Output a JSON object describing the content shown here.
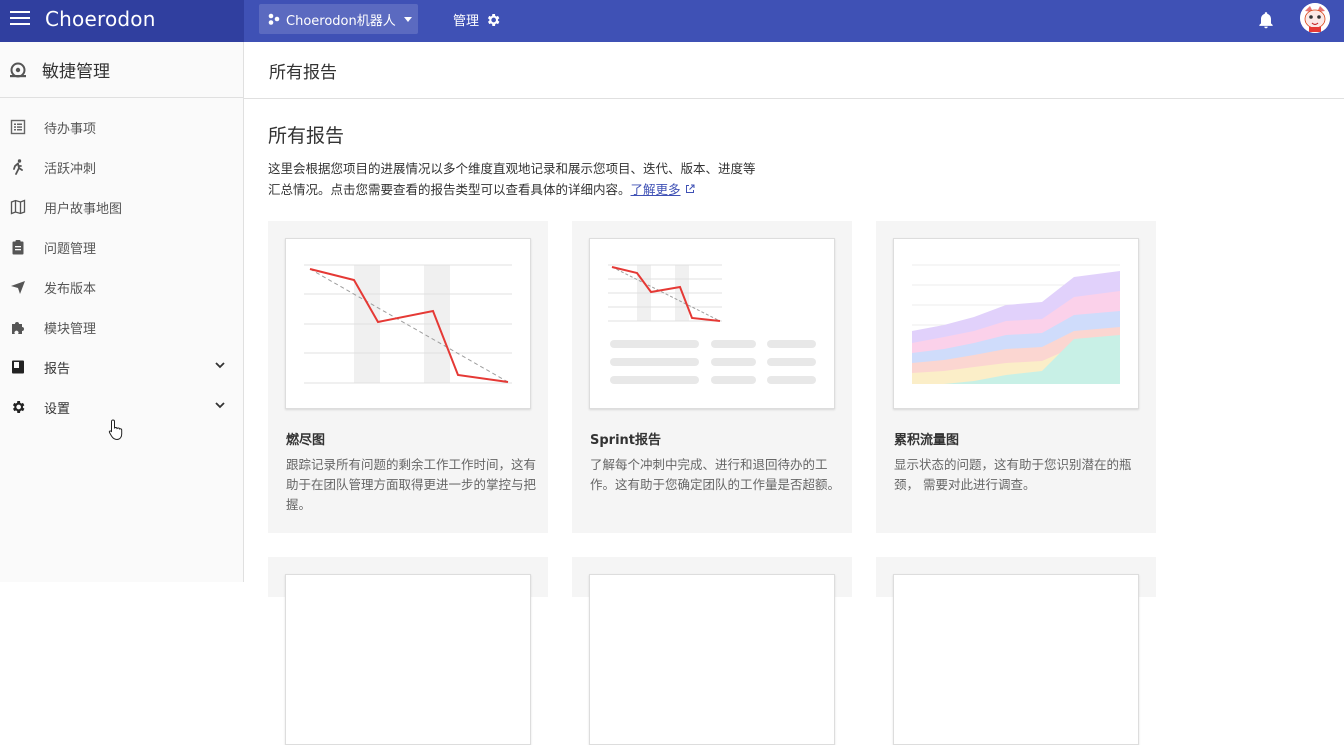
{
  "topbar": {
    "logo": "Choerodon",
    "project": "Choerodon机器人",
    "manage": "管理"
  },
  "sidebar": {
    "title": "敏捷管理",
    "items": [
      {
        "label": "待办事项",
        "icon": "backlog-icon"
      },
      {
        "label": "活跃冲刺",
        "icon": "run-icon"
      },
      {
        "label": "用户故事地图",
        "icon": "map-icon"
      },
      {
        "label": "问题管理",
        "icon": "clipboard-icon"
      },
      {
        "label": "发布版本",
        "icon": "send-icon"
      },
      {
        "label": "模块管理",
        "icon": "puzzle-icon"
      },
      {
        "label": "报告",
        "icon": "book-icon"
      },
      {
        "label": "设置",
        "icon": "gear-icon"
      }
    ]
  },
  "page": {
    "header": "所有报告",
    "title": "所有报告",
    "description_line1": "这里会根据您项目的进展情况以多个维度直观地记录和展示您项目、迭代、版本、进度等",
    "description_line2": "汇总情况。点击您需要查看的报告类型可以查看具体的详细内容。",
    "learn_more": "了解更多"
  },
  "cards": [
    {
      "title": "燃尽图",
      "desc": "跟踪记录所有问题的剩余工作工作时间，这有助于在团队管理方面取得更进一步的掌控与把握。"
    },
    {
      "title": "Sprint报告",
      "desc": "了解每个冲刺中完成、进行和退回待办的工作。这有助于您确定团队的工作量是否超额。"
    },
    {
      "title": "累积流量图",
      "desc": "显示状态的问题，这有助于您识别潜在的瓶颈， 需要对此进行调查。"
    }
  ],
  "colors": {
    "primary": "#3f51b5",
    "primary_dark": "#303f9f",
    "chart_line": "#e53935"
  }
}
